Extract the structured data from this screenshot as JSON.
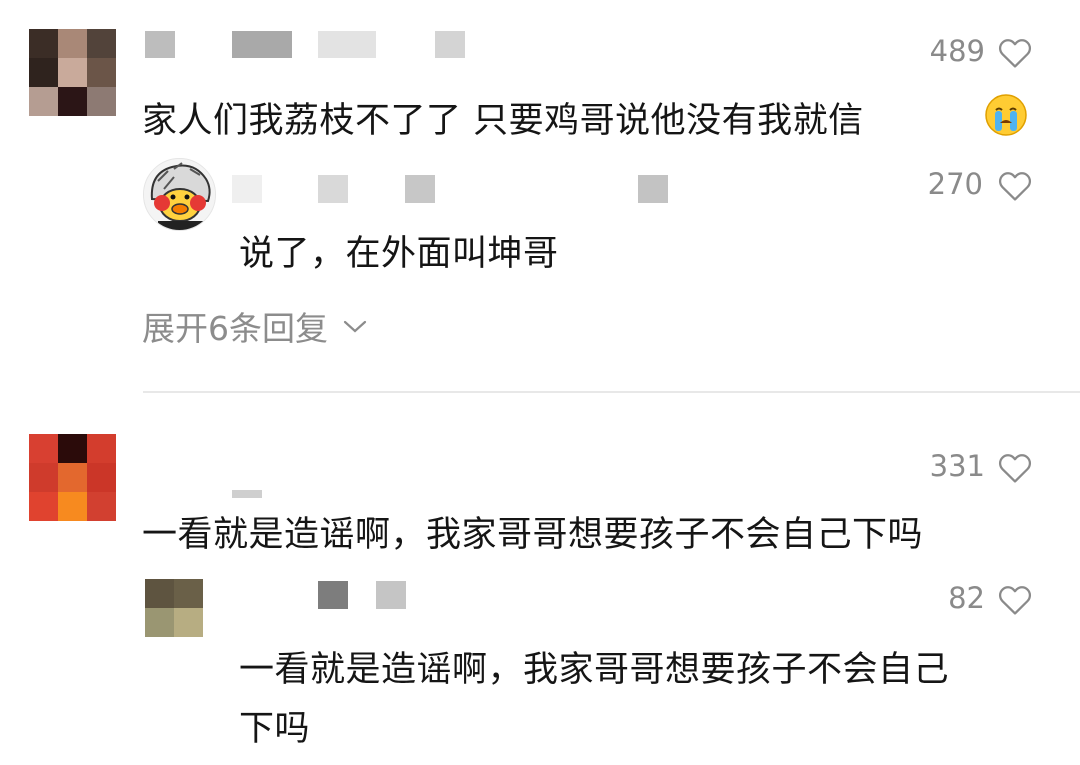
{
  "comments": [
    {
      "likes": "489",
      "text": "家人们我荔枝不了了 只要鸡哥说他没有我就信",
      "emoji": "crying-face-emoji"
    },
    {
      "likes": "270",
      "text": "说了，在外面叫坤哥"
    },
    {
      "likes": "331",
      "text": "一看就是造谣啊，我家哥哥想要孩子不会自己下吗"
    },
    {
      "likes": "82",
      "text_line1": "一看就是造谣啊，我家哥哥想要孩子不会自己",
      "text_line2": "下吗"
    }
  ],
  "expand_replies": "展开6条回复",
  "icons": {
    "like": "heart-outline-icon",
    "expand": "chevron-down-icon"
  },
  "colors": {
    "count_gray": "#8a8a8a",
    "text": "#151515",
    "divider": "#e8e8e8"
  }
}
